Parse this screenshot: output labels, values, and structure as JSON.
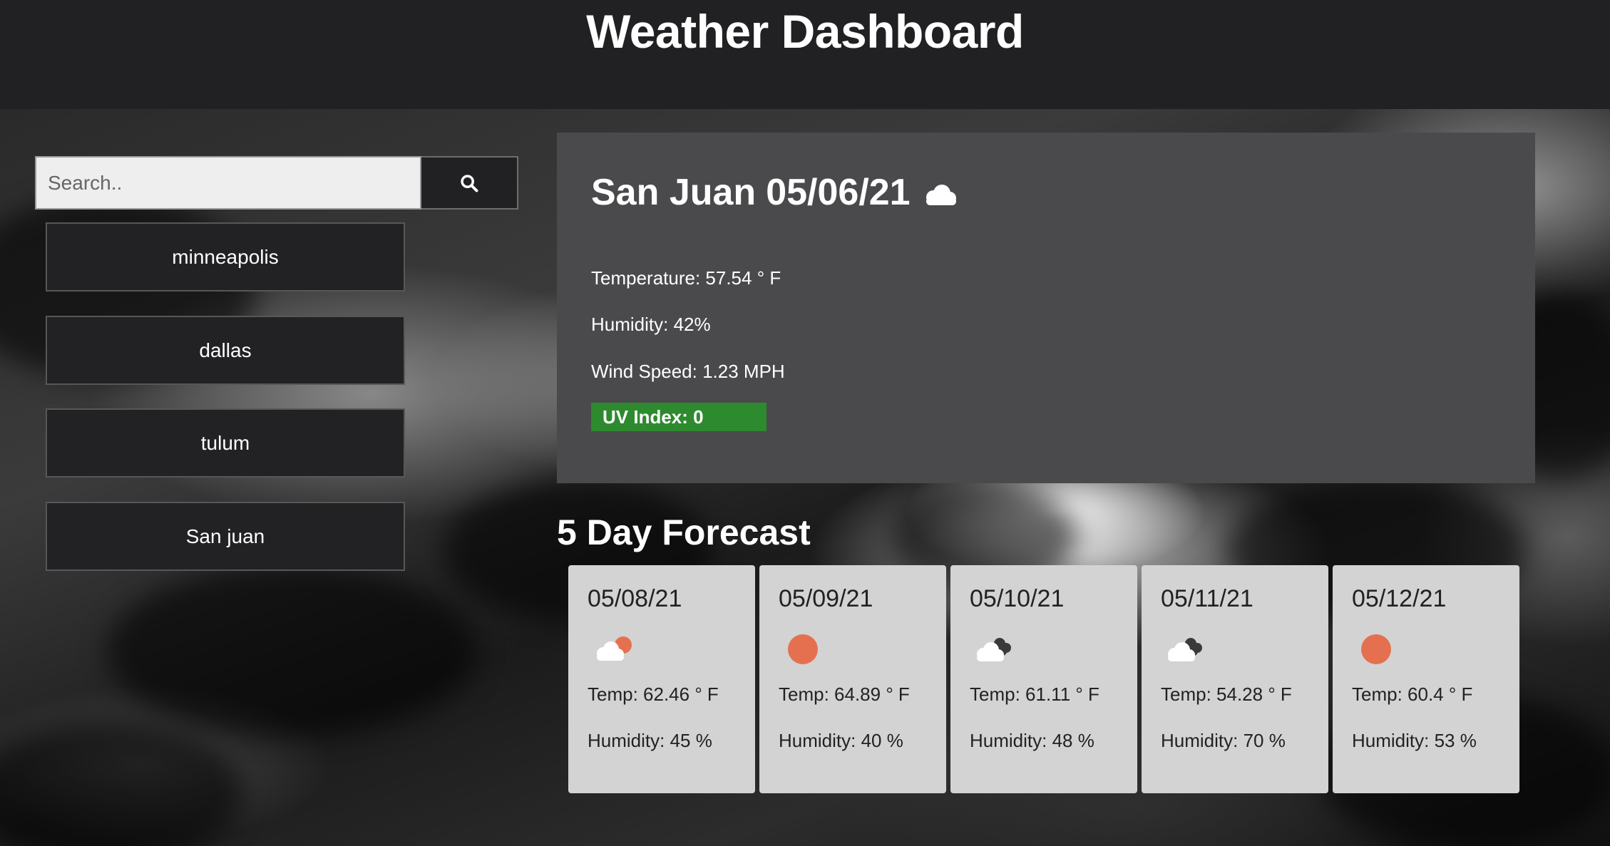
{
  "header": {
    "title": "Weather Dashboard"
  },
  "search": {
    "placeholder": "Search..",
    "button_icon": "search-icon"
  },
  "history": {
    "items": [
      {
        "label": "minneapolis"
      },
      {
        "label": "dallas"
      },
      {
        "label": "tulum"
      },
      {
        "label": "San juan"
      }
    ]
  },
  "current": {
    "city": "San Juan",
    "date": "05/06/21",
    "icon": "cloud-icon",
    "temperature": "Temperature: 57.54 ° F",
    "humidity": "Humidity: 42%",
    "wind": "Wind Speed: 1.23 MPH",
    "uv": "UV Index: 0",
    "uv_color": "#2e8a2e"
  },
  "forecast": {
    "heading": "5 Day Forecast",
    "days": [
      {
        "date": "05/08/21",
        "icon": "partly-cloudy-icon",
        "temp": "Temp: 62.46 ° F",
        "humidity": "Humidity: 45 %"
      },
      {
        "date": "05/09/21",
        "icon": "sun-icon",
        "temp": "Temp: 64.89 ° F",
        "humidity": "Humidity: 40 %"
      },
      {
        "date": "05/10/21",
        "icon": "broken-clouds-icon",
        "temp": "Temp: 61.11 ° F",
        "humidity": "Humidity: 48 %"
      },
      {
        "date": "05/11/21",
        "icon": "broken-clouds-icon",
        "temp": "Temp: 54.28 ° F",
        "humidity": "Humidity: 70 %"
      },
      {
        "date": "05/12/21",
        "icon": "sun-icon",
        "temp": "Temp: 60.4 ° F",
        "humidity": "Humidity: 53 %"
      }
    ]
  },
  "colors": {
    "header_bg": "#212124",
    "panel_bg": "#4a4a4c",
    "card_bg": "#d3d3d3",
    "sun": "#e5704f"
  }
}
